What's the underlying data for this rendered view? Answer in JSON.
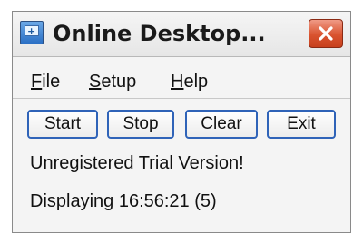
{
  "window": {
    "title": "Online Desktop...",
    "icon": "app-monitor-icon",
    "close_icon": "close-icon"
  },
  "menu": {
    "items": [
      {
        "accel": "F",
        "rest": "ile"
      },
      {
        "accel": "S",
        "rest": "etup"
      },
      {
        "accel": "H",
        "rest": "elp"
      }
    ]
  },
  "toolbar": {
    "start_label": "Start",
    "stop_label": "Stop",
    "clear_label": "Clear",
    "exit_label": "Exit"
  },
  "status": {
    "line1": "Unregistered Trial Version!",
    "line2": "Displaying 16:56:21 (5)"
  },
  "colors": {
    "close_button": "#d9532f",
    "button_border": "#2f63b8",
    "window_bg": "#f4f4f4"
  }
}
